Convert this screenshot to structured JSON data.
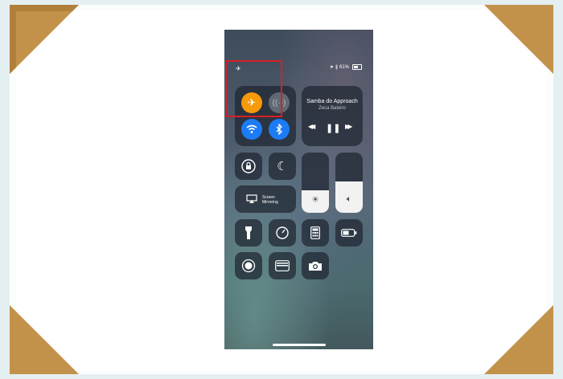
{
  "status_bar": {
    "airplane_glyph": "✈",
    "battery_text": "61%"
  },
  "music": {
    "title": "Samba do Approach",
    "artist": "Zeca Baleiro",
    "prev_glyph": "◀◀",
    "play_pause_glyph": "❚❚",
    "next_glyph": "▶▶"
  },
  "connectivity": {
    "airplane_mode": "on",
    "cellular_data": "off",
    "wifi": "on",
    "bluetooth": "on"
  },
  "screen_mirroring": {
    "label_line1": "Screen",
    "label_line2": "Mirroring"
  },
  "sliders": {
    "brightness_level": 0.38,
    "volume_level": 0.52
  },
  "colors": {
    "airplane_orange": "#f69a0a",
    "toggle_blue": "#1d7bf5",
    "highlight_red": "#d81f26",
    "frame_corner": "#c2924a"
  }
}
